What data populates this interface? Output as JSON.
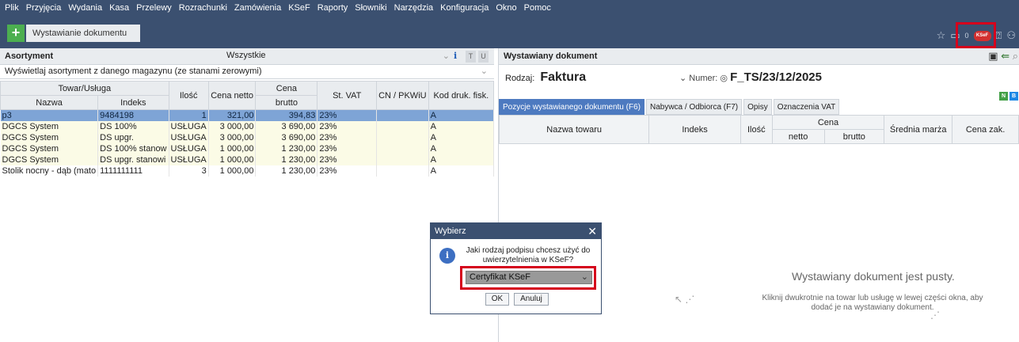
{
  "menu": [
    "Plik",
    "Przyjęcia",
    "Wydania",
    "Kasa",
    "Przelewy",
    "Rozrachunki",
    "Zamówienia",
    "KSeF",
    "Raporty",
    "Słowniki",
    "Narzędzia",
    "Konfiguracja",
    "Okno",
    "Pomoc"
  ],
  "toolbar": {
    "add_label": "+",
    "tab_label": "Wystawianie dokumentu",
    "counter": "0",
    "ksef_badge": "KSeF"
  },
  "left": {
    "title": "Asortyment",
    "filter_value": "Wszystkie",
    "btn_t": "T",
    "btn_u": "U",
    "magazyn_value": "Wyświetlaj asortyment z danego magazynu (ze stanami zerowymi)",
    "header_group_towar": "Towar/Usługa",
    "header_cena": "Cena",
    "columns": [
      "Nazwa",
      "Indeks",
      "Ilość",
      "Cena netto",
      "brutto",
      "St. VAT",
      "CN / PKWiU",
      "Kod druk. fisk."
    ],
    "rows": [
      {
        "nazwa": "p3",
        "indeks": "9484198",
        "ilosc": "1",
        "netto": "321,00",
        "brutto": "394,83",
        "vat": "23%",
        "cn": "",
        "kod": "A",
        "state": "selected"
      },
      {
        "nazwa": "DGCS System",
        "indeks": "DS 100%",
        "ilosc": "USŁUGA",
        "netto": "3 000,00",
        "brutto": "3 690,00",
        "vat": "23%",
        "cn": "",
        "kod": "A",
        "state": "service"
      },
      {
        "nazwa": "DGCS System",
        "indeks": "DS upgr.",
        "ilosc": "USŁUGA",
        "netto": "3 000,00",
        "brutto": "3 690,00",
        "vat": "23%",
        "cn": "",
        "kod": "A",
        "state": "service"
      },
      {
        "nazwa": "DGCS System",
        "indeks": "DS 100% stanow",
        "ilosc": "USŁUGA",
        "netto": "1 000,00",
        "brutto": "1 230,00",
        "vat": "23%",
        "cn": "",
        "kod": "A",
        "state": "service"
      },
      {
        "nazwa": "DGCS System",
        "indeks": "DS upgr. stanowi",
        "ilosc": "USŁUGA",
        "netto": "1 000,00",
        "brutto": "1 230,00",
        "vat": "23%",
        "cn": "",
        "kod": "A",
        "state": "service"
      },
      {
        "nazwa": "Stolik nocny - dąb (mato",
        "indeks": "1111111111",
        "ilosc": "3",
        "netto": "1 000,00",
        "brutto": "1 230,00",
        "vat": "23%",
        "cn": "",
        "kod": "A",
        "state": "normal"
      }
    ]
  },
  "right": {
    "title": "Wystawiany dokument",
    "rodzaj_label": "Rodzaj:",
    "rodzaj_value": "Faktura",
    "numer_label": "Numer:",
    "numer_value": "F_TS/23/12/2025",
    "badge_n": "N",
    "badge_b": "B",
    "tabs": [
      "Pozycje wystawianego dokumentu (F6)",
      "Nabywca / Odbiorca (F7)",
      "Opisy",
      "Oznaczenia VAT"
    ],
    "columns": [
      "Nazwa towaru",
      "Indeks",
      "Ilość",
      "Cena",
      "netto",
      "brutto",
      "Średnia marża",
      "Cena zak."
    ],
    "empty_title": "Wystawiany dokument jest pusty.",
    "empty_hint": "Kliknij dwukrotnie na towar lub usługę w lewej części okna, aby dodać je na wystawiany dokument."
  },
  "modal": {
    "title": "Wybierz",
    "message": "Jaki rodzaj podpisu chcesz użyć do uwierzytelnienia w KSeF?",
    "select_value": "Certyfikat KSeF",
    "ok": "OK",
    "cancel": "Anuluj"
  },
  "colors": {
    "header_bg": "#3b5070",
    "selection": "#7ea4d6",
    "service_row": "#fbfbe6",
    "highlight": "#d5001c"
  }
}
